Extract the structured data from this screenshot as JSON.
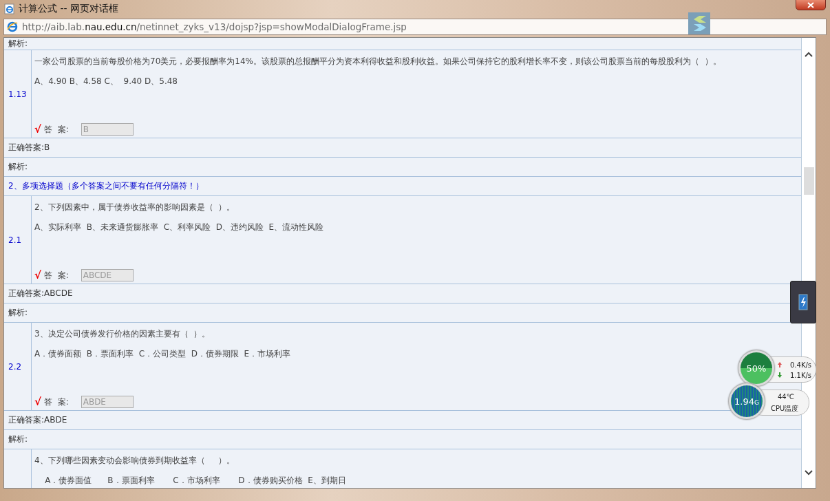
{
  "window": {
    "title": "计算公式 -- 网页对话框"
  },
  "address": {
    "prefix": "http://aib.lab.",
    "domain": "nau.edu.cn",
    "path": "/netinnet_zyks_v13/dojsp?jsp=showModalDialogFrame.jsp"
  },
  "rows": [
    {
      "kind": "analysis",
      "text": "解析:"
    },
    {
      "kind": "question",
      "number": "1.13",
      "question": "一家公司股票的当前每股价格为70美元，必要报酬率为14%。该股票的总报酬平分为资本利得收益和股利收益。如果公司保持它的股利增长率不变，则该公司股票当前的每股股利为（  ）。",
      "options": "A、4.90 B、4.58 C、  9.40 D、5.48",
      "mark": "√",
      "answer_label": "答  案:",
      "answer": "B"
    },
    {
      "kind": "correct",
      "text": "正确答案:B"
    },
    {
      "kind": "analysis",
      "text": "解析:"
    },
    {
      "kind": "section",
      "text": "2、多项选择题（多个答案之间不要有任何分隔符！）"
    },
    {
      "kind": "question",
      "number": "2.1",
      "question": "2、下列因素中，属于债券收益率的影响因素是（  ）。",
      "options": "A、实际利率  B、未来通货膨胀率  C、利率风险  D、违约风险  E、流动性风险",
      "mark": "√",
      "answer_label": "答  案:",
      "answer": "ABCDE"
    },
    {
      "kind": "correct",
      "text": "正确答案:ABCDE"
    },
    {
      "kind": "analysis",
      "text": "解析:"
    },
    {
      "kind": "question",
      "number": "2.2",
      "question": "3、决定公司债券发行价格的因素主要有（  ）。",
      "options": "A．债券面额  B．票面利率  C．公司类型  D．债券期限  E．市场利率",
      "mark": "√",
      "answer_label": "答  案:",
      "answer": "ABDE"
    },
    {
      "kind": "correct",
      "text": "正确答案:ABDE"
    },
    {
      "kind": "analysis",
      "text": "解析:"
    },
    {
      "kind": "question",
      "question": "4、下列哪些因素变动会影响债券到期收益率（     ）。",
      "options": "    A．债券面值      B．票面利率       C．市场利率       D．债券购买价格  E、到期日"
    }
  ],
  "network": {
    "usage": "50%",
    "up": "0.4K/s",
    "down": "1.1K/s"
  },
  "memory": {
    "value": "1.94",
    "unit": "G",
    "temperature": "44℃",
    "temperature_label": "CPU温度"
  }
}
